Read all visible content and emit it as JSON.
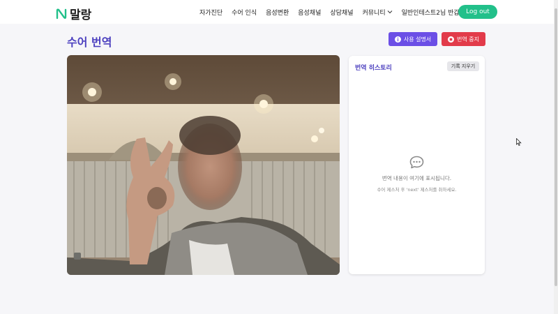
{
  "header": {
    "logo_text": "말랑",
    "nav": [
      "자가진단",
      "수어 인식",
      "음성변환",
      "음성채널",
      "상담채널"
    ],
    "community": "커뮤니티",
    "greeting": "일반인테스트2님 반갑습니다",
    "logout": "Log out"
  },
  "page": {
    "title": "수어 번역",
    "guide_button": "사용 설명서",
    "stop_button": "번역 중지"
  },
  "history": {
    "title": "번역 히스토리",
    "clear_button": "기록 지우기",
    "empty_message": "번역 내용이 여기에 표시됩니다.",
    "empty_hint": "수어 제스처 후 'next' 제스처를 취하세요."
  },
  "colors": {
    "accent": "#4b3fbf",
    "brand": "#22c08a",
    "guide": "#6b4fe6",
    "stop": "#e23b4a"
  },
  "icons": [
    "logo-icon",
    "chevron-down-icon",
    "info-icon",
    "stop-icon",
    "chat-bubble-icon",
    "mouse-cursor-icon"
  ]
}
